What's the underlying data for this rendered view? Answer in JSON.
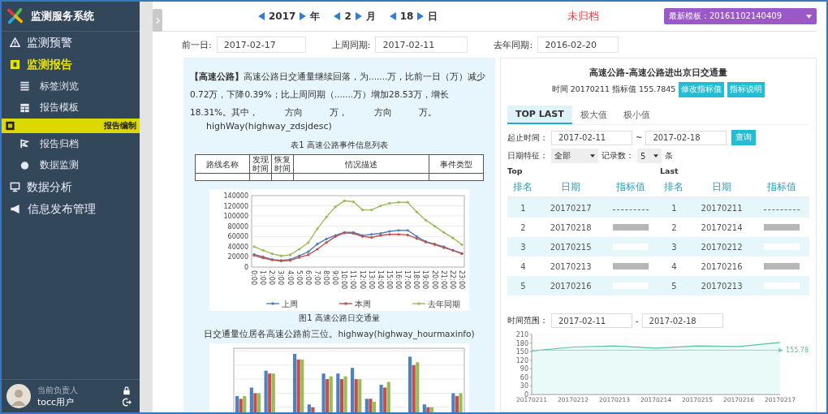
{
  "app": {
    "title": "监测服务系统"
  },
  "sidebar": {
    "items": [
      {
        "label": "监测预警",
        "expanded": false
      },
      {
        "label": "监测报告",
        "expanded": true,
        "children": [
          {
            "label": "标签浏览",
            "selected": false
          },
          {
            "label": "报告模板",
            "selected": false
          },
          {
            "label": "报告编制",
            "selected": true
          },
          {
            "label": "报告归档",
            "selected": false
          },
          {
            "label": "数据监测",
            "selected": false
          }
        ]
      },
      {
        "label": "数据分析",
        "expanded": false
      },
      {
        "label": "信息发布管理",
        "expanded": false
      }
    ],
    "user": {
      "role": "当前负责人",
      "name": "tocc用户"
    }
  },
  "date_nav": {
    "year": "2017",
    "year_unit": "年",
    "month": "2",
    "month_unit": "月",
    "day": "18",
    "day_unit": "日"
  },
  "status": "未归档",
  "template_select": {
    "value": "最新模板：20161102140409"
  },
  "compare_fields": [
    {
      "label": "前一日:",
      "value": "2017-02-17"
    },
    {
      "label": "上周同期:",
      "value": "2017-02-11"
    },
    {
      "label": "去年同期:",
      "value": "2016-02-20"
    }
  ],
  "report": {
    "paragraph": "**【高速公路】**高速公路日交通量继续回落，为.......万，比前一日（万）减少0.72万，下降0.39%；比上周同期（.......万）增加28.53万，增长18.31%。其中，　　　方向　　　万，　　　方向　　　万。",
    "source": "highWay(highway_zdsjdesc)",
    "table": {
      "caption": "表1 高速公路事件信息列表",
      "columns": [
        "路线名称",
        "发现时间",
        "恢复时间",
        "情况描述",
        "事件类型"
      ]
    },
    "chart_data": {
      "type": "line",
      "grid": true,
      "legend": "bottom",
      "categories": [
        "0:00",
        "1:00",
        "2:00",
        "3:00",
        "4:00",
        "5:00",
        "6:00",
        "7:00",
        "8:00",
        "9:00",
        "10:00",
        "11:00",
        "12:00",
        "13:00",
        "14:00",
        "15:00",
        "16:00",
        "17:00",
        "18:00",
        "19:00",
        "20:00",
        "21:00",
        "22:00",
        "23:00"
      ],
      "ylim": [
        0,
        140000
      ],
      "yticks": [
        0,
        20000,
        40000,
        60000,
        80000,
        100000,
        120000,
        140000
      ],
      "series": [
        {
          "name": "上周",
          "color": "#4f81bd",
          "values": [
            25000,
            20000,
            15000,
            13000,
            15000,
            22000,
            30000,
            45000,
            55000,
            62000,
            68000,
            68000,
            62000,
            64000,
            66000,
            70000,
            72000,
            72000,
            60000,
            50000,
            45000,
            40000,
            33000,
            27000
          ]
        },
        {
          "name": "本周",
          "color": "#c0504d",
          "values": [
            23000,
            18000,
            14000,
            12000,
            13000,
            19000,
            24000,
            35000,
            48000,
            60000,
            67000,
            66000,
            60000,
            58000,
            62000,
            64000,
            64000,
            63000,
            56000,
            49000,
            44000,
            38000,
            33000,
            26000
          ]
        },
        {
          "name": "去年同期",
          "color": "#9bbb59",
          "values": [
            40000,
            33000,
            26000,
            22000,
            24000,
            35000,
            48000,
            75000,
            98000,
            118000,
            130000,
            128000,
            112000,
            112000,
            120000,
            125000,
            127000,
            127000,
            108000,
            92000,
            80000,
            68000,
            57000,
            44000
          ]
        }
      ]
    },
    "figure_caption": "图1 高速公路日交通量",
    "sentence": "日交通量位居各高速公路前三位。highway(highway_hourmaxinfo)"
  },
  "right": {
    "title": "高速公路-高速公路进出京日交通量",
    "info": "时间 20170211 指标值 155.7845",
    "buttons": [
      "修改指标值",
      "指标说明"
    ],
    "tabs": [
      {
        "label": "TOP LAST",
        "selected": true
      },
      {
        "label": "极大值",
        "selected": false
      },
      {
        "label": "极小值",
        "selected": false
      }
    ],
    "range": {
      "label": "起止时间：",
      "from": "2017-02-11",
      "sep": "~",
      "to": "2017-02-18",
      "button": "查询"
    },
    "filters": {
      "day_label": "日期特征：",
      "day_value": "全部",
      "count_label": "记录数：",
      "count_value": "5",
      "count_unit": "条"
    },
    "top_label": "Top",
    "last_label": "Last",
    "columns": [
      "排名",
      "日期",
      "指标值",
      "排名",
      "日期",
      "指标值"
    ],
    "rows": [
      {
        "top": {
          "rank": "1",
          "date": "20170217",
          "kind": "dashes"
        },
        "last": {
          "rank": "1",
          "date": "20170211",
          "kind": "dashes"
        }
      },
      {
        "top": {
          "rank": "2",
          "date": "20170218",
          "kind": "gray"
        },
        "last": {
          "rank": "2",
          "date": "20170214",
          "kind": "gray"
        }
      },
      {
        "top": {
          "rank": "3",
          "date": "20170215",
          "kind": "blank"
        },
        "last": {
          "rank": "3",
          "date": "20170212",
          "kind": "blank"
        }
      },
      {
        "top": {
          "rank": "4",
          "date": "20170213",
          "kind": "gray"
        },
        "last": {
          "rank": "4",
          "date": "20170216",
          "kind": "gray"
        }
      },
      {
        "top": {
          "rank": "5",
          "date": "20170216",
          "kind": "blank"
        },
        "last": {
          "rank": "5",
          "date": "20170213",
          "kind": "blank"
        }
      }
    ],
    "trend": {
      "label": "时间范围：",
      "from": "2017-02-11",
      "sep": "-",
      "to": "2017-02-18",
      "chart_data": {
        "type": "area",
        "categories": [
          "20170211",
          "20170212",
          "20170213",
          "20170214",
          "20170215",
          "20170216",
          "20170217"
        ],
        "ylim": [
          0,
          210
        ],
        "yticks": [
          0,
          30,
          60,
          90,
          120,
          150,
          180,
          210
        ],
        "series": [
          {
            "color": "#5cc0a0",
            "values": [
              152,
              166,
              170,
              162,
              170,
              168,
              182
            ]
          }
        ]
      },
      "ref_label": "155.78"
    }
  }
}
